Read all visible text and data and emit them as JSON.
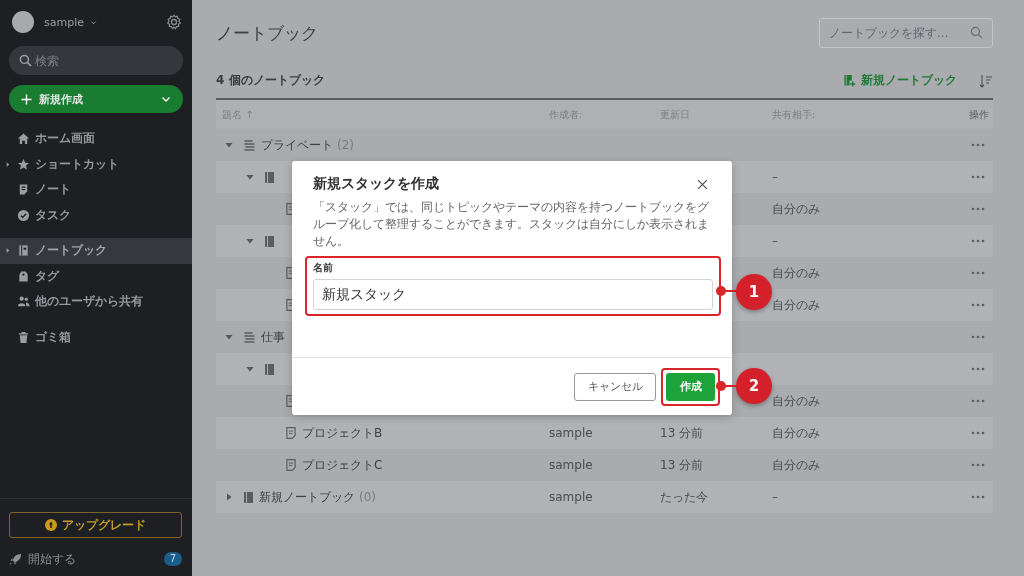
{
  "sidebar": {
    "user": "sample",
    "search": {
      "placeholder": "検索"
    },
    "new_button": "新規作成",
    "items": [
      {
        "label": "ホーム画面",
        "expandable": false,
        "selected": false
      },
      {
        "label": "ショートカット",
        "expandable": true,
        "selected": false
      },
      {
        "label": "ノート",
        "expandable": false,
        "selected": false
      },
      {
        "label": "タスク",
        "expandable": false,
        "selected": false
      },
      {
        "label": "ノートブック",
        "expandable": true,
        "selected": true
      },
      {
        "label": "タグ",
        "expandable": false,
        "selected": false
      },
      {
        "label": "他のユーザから共有",
        "expandable": false,
        "selected": false
      },
      {
        "label": "ゴミ箱",
        "expandable": false,
        "selected": false
      }
    ],
    "upgrade": "アップグレード",
    "start": {
      "label": "開始する",
      "badge": "7"
    }
  },
  "main": {
    "title": "ノートブック",
    "search": {
      "placeholder": "ノートブックを探す..."
    },
    "count": "4 個のノートブック",
    "new_notebook": "新規ノートブック",
    "table": {
      "columns": [
        "題名 ↑",
        "作成者:",
        "更新日",
        "共有相手:",
        "操作"
      ],
      "rows": [
        {
          "kind": "stack",
          "name": "プライベート",
          "count": "(2)",
          "expanded": true,
          "children": [
            {
              "kind": "notebook",
              "shared": "–",
              "expanded": true,
              "children": [
                {
                  "kind": "note",
                  "shared": "自分のみ"
                }
              ]
            },
            {
              "kind": "notebook",
              "shared": "–",
              "expanded": true,
              "children": [
                {
                  "kind": "note",
                  "shared": "自分のみ"
                },
                {
                  "kind": "note",
                  "shared": "自分のみ"
                }
              ]
            }
          ]
        },
        {
          "kind": "stack",
          "name": "仕事",
          "expanded": true,
          "children": [
            {
              "kind": "notebook",
              "expanded": true,
              "children": [
                {
                  "kind": "note",
                  "shared": "自分のみ"
                },
                {
                  "kind": "note",
                  "name": "プロジェクトB",
                  "creator": "sample",
                  "updated": "13 分前",
                  "shared": "自分のみ"
                },
                {
                  "kind": "note",
                  "name": "プロジェクトC",
                  "creator": "sample",
                  "updated": "13 分前",
                  "shared": "自分のみ"
                }
              ]
            }
          ]
        },
        {
          "kind": "notebook",
          "name": "新規ノートブック",
          "count": "(0)",
          "creator": "sample",
          "updated": "たった今",
          "shared": "–",
          "expanded": false
        }
      ]
    }
  },
  "dialog": {
    "title": "新規スタックを作成",
    "description": "「スタック」では、同じトピックやテーマの内容を持つノートブックをグループ化して整理することができます。スタックは自分にしか表示されません。",
    "field_label": "名前",
    "field_value": "新規スタック",
    "buttons": [
      {
        "label": "キャンセル",
        "kind": "secondary"
      },
      {
        "label": "作成",
        "kind": "primary"
      }
    ]
  },
  "annotations": [
    {
      "label": "1"
    },
    {
      "label": "2"
    }
  ]
}
